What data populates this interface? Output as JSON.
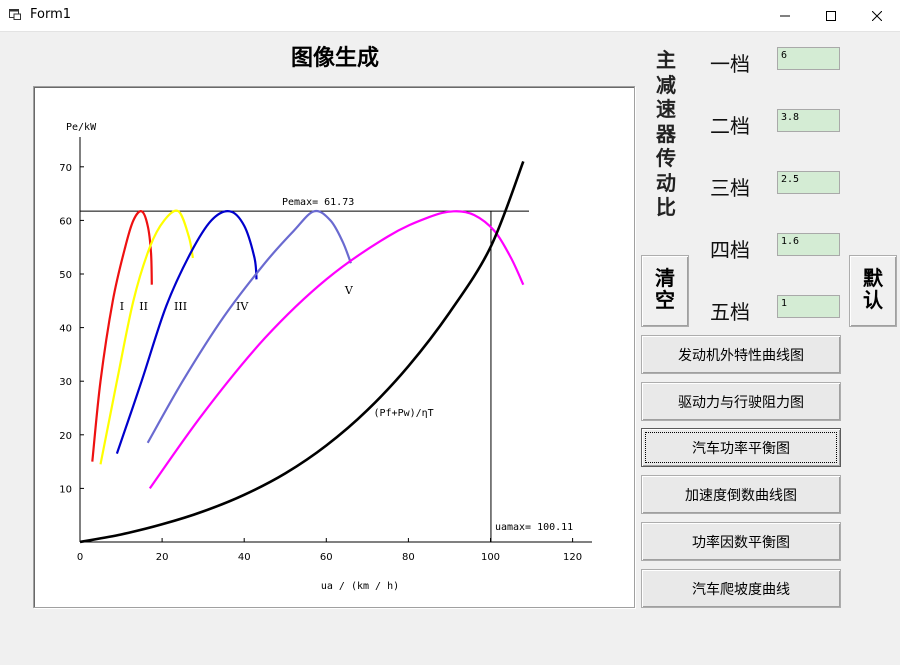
{
  "window": {
    "title": "Form1",
    "minimize_icon": "minimize-icon",
    "maximize_icon": "maximize-icon",
    "close_icon": "close-icon"
  },
  "heading": "图像生成",
  "ratio_title": "主减速器传动比",
  "gears": [
    {
      "label": "一档",
      "value": "6"
    },
    {
      "label": "二档",
      "value": "3.8"
    },
    {
      "label": "三档",
      "value": "2.5"
    },
    {
      "label": "四档",
      "value": "1.6"
    },
    {
      "label": "五档",
      "value": "1"
    }
  ],
  "clear_button": "清空",
  "default_button": "默认",
  "actions": [
    "发动机外特性曲线图",
    "驱动力与行驶阻力图",
    "汽车功率平衡图",
    "加速度倒数曲线图",
    "功率因数平衡图",
    "汽车爬坡度曲线"
  ],
  "colors": {
    "gear_I": "#ee1111",
    "gear_II": "#ffff00",
    "gear_III": "#0000cc",
    "gear_IV": "#6a6ad0",
    "gear_V": "#ff00ff",
    "resistance": "#000000",
    "input_bg": "#d4ecd4"
  },
  "chart_data": {
    "type": "line",
    "xlabel": "ua / (km / h)",
    "ylabel": "Pe/kW",
    "xlim": [
      0,
      125
    ],
    "ylim": [
      0,
      75
    ],
    "x_ticks": [
      0,
      20,
      40,
      60,
      80,
      100,
      120
    ],
    "y_ticks": [
      10,
      20,
      30,
      40,
      50,
      60,
      70
    ],
    "gear_labels": [
      "I",
      "II",
      "III",
      "IV",
      "V"
    ],
    "annotations": {
      "pemax": "Pemax= 61.73",
      "uamax": "uamax= 100.11",
      "resistance": "(Pf+Pw)/ηT"
    },
    "pemax": 61.73,
    "uamax": 100.11,
    "series": [
      {
        "gear": "I",
        "x": [
          3,
          5,
          8,
          11,
          13,
          15,
          16.5,
          17.3,
          17.5
        ],
        "y": [
          15,
          30,
          45,
          55,
          60,
          61.7,
          59,
          54,
          48
        ]
      },
      {
        "gear": "II",
        "x": [
          5,
          9,
          13,
          17,
          20.5,
          24,
          26.5,
          27.5
        ],
        "y": [
          14.5,
          30,
          45,
          55,
          60,
          61.7,
          57,
          53
        ]
      },
      {
        "gear": "III",
        "x": [
          9,
          15,
          21,
          27,
          32,
          36.5,
          40,
          42.5,
          43
        ],
        "y": [
          16.5,
          30,
          44,
          54,
          60,
          61.7,
          59,
          53,
          49
        ]
      },
      {
        "gear": "IV",
        "x": [
          16.5,
          25,
          35,
          45,
          52,
          57,
          61,
          64,
          66
        ],
        "y": [
          18.5,
          30,
          42,
          52,
          58,
          61.7,
          60,
          56,
          52
        ]
      },
      {
        "gear": "V",
        "x": [
          17,
          30,
          45,
          60,
          75,
          85,
          91,
          96,
          101,
          105,
          108
        ],
        "y": [
          10,
          24,
          38,
          49,
          57,
          60.6,
          61.7,
          61,
          58,
          53,
          48
        ]
      },
      {
        "name": "(Pf+Pw)/ηT",
        "x": [
          0,
          10,
          20,
          30,
          40,
          50,
          60,
          70,
          80,
          90,
          100,
          108
        ],
        "y": [
          0,
          1.4,
          3.3,
          5.7,
          8.8,
          12.8,
          18,
          24.6,
          32.8,
          42.8,
          55,
          71
        ]
      }
    ]
  }
}
